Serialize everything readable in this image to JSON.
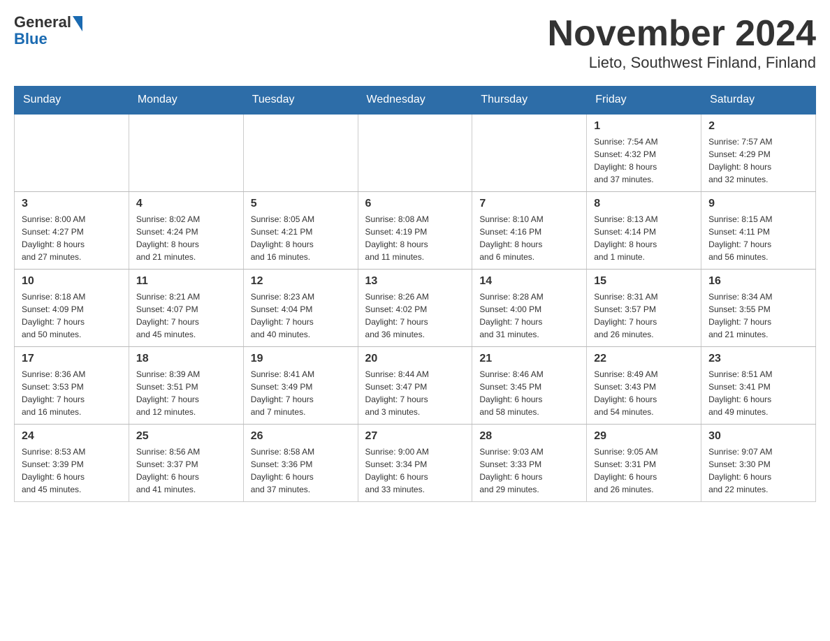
{
  "header": {
    "logo": {
      "general": "General",
      "blue": "Blue"
    },
    "title": "November 2024",
    "subtitle": "Lieto, Southwest Finland, Finland"
  },
  "calendar": {
    "days_of_week": [
      "Sunday",
      "Monday",
      "Tuesday",
      "Wednesday",
      "Thursday",
      "Friday",
      "Saturday"
    ],
    "weeks": [
      [
        {
          "day": "",
          "info": ""
        },
        {
          "day": "",
          "info": ""
        },
        {
          "day": "",
          "info": ""
        },
        {
          "day": "",
          "info": ""
        },
        {
          "day": "",
          "info": ""
        },
        {
          "day": "1",
          "info": "Sunrise: 7:54 AM\nSunset: 4:32 PM\nDaylight: 8 hours\nand 37 minutes."
        },
        {
          "day": "2",
          "info": "Sunrise: 7:57 AM\nSunset: 4:29 PM\nDaylight: 8 hours\nand 32 minutes."
        }
      ],
      [
        {
          "day": "3",
          "info": "Sunrise: 8:00 AM\nSunset: 4:27 PM\nDaylight: 8 hours\nand 27 minutes."
        },
        {
          "day": "4",
          "info": "Sunrise: 8:02 AM\nSunset: 4:24 PM\nDaylight: 8 hours\nand 21 minutes."
        },
        {
          "day": "5",
          "info": "Sunrise: 8:05 AM\nSunset: 4:21 PM\nDaylight: 8 hours\nand 16 minutes."
        },
        {
          "day": "6",
          "info": "Sunrise: 8:08 AM\nSunset: 4:19 PM\nDaylight: 8 hours\nand 11 minutes."
        },
        {
          "day": "7",
          "info": "Sunrise: 8:10 AM\nSunset: 4:16 PM\nDaylight: 8 hours\nand 6 minutes."
        },
        {
          "day": "8",
          "info": "Sunrise: 8:13 AM\nSunset: 4:14 PM\nDaylight: 8 hours\nand 1 minute."
        },
        {
          "day": "9",
          "info": "Sunrise: 8:15 AM\nSunset: 4:11 PM\nDaylight: 7 hours\nand 56 minutes."
        }
      ],
      [
        {
          "day": "10",
          "info": "Sunrise: 8:18 AM\nSunset: 4:09 PM\nDaylight: 7 hours\nand 50 minutes."
        },
        {
          "day": "11",
          "info": "Sunrise: 8:21 AM\nSunset: 4:07 PM\nDaylight: 7 hours\nand 45 minutes."
        },
        {
          "day": "12",
          "info": "Sunrise: 8:23 AM\nSunset: 4:04 PM\nDaylight: 7 hours\nand 40 minutes."
        },
        {
          "day": "13",
          "info": "Sunrise: 8:26 AM\nSunset: 4:02 PM\nDaylight: 7 hours\nand 36 minutes."
        },
        {
          "day": "14",
          "info": "Sunrise: 8:28 AM\nSunset: 4:00 PM\nDaylight: 7 hours\nand 31 minutes."
        },
        {
          "day": "15",
          "info": "Sunrise: 8:31 AM\nSunset: 3:57 PM\nDaylight: 7 hours\nand 26 minutes."
        },
        {
          "day": "16",
          "info": "Sunrise: 8:34 AM\nSunset: 3:55 PM\nDaylight: 7 hours\nand 21 minutes."
        }
      ],
      [
        {
          "day": "17",
          "info": "Sunrise: 8:36 AM\nSunset: 3:53 PM\nDaylight: 7 hours\nand 16 minutes."
        },
        {
          "day": "18",
          "info": "Sunrise: 8:39 AM\nSunset: 3:51 PM\nDaylight: 7 hours\nand 12 minutes."
        },
        {
          "day": "19",
          "info": "Sunrise: 8:41 AM\nSunset: 3:49 PM\nDaylight: 7 hours\nand 7 minutes."
        },
        {
          "day": "20",
          "info": "Sunrise: 8:44 AM\nSunset: 3:47 PM\nDaylight: 7 hours\nand 3 minutes."
        },
        {
          "day": "21",
          "info": "Sunrise: 8:46 AM\nSunset: 3:45 PM\nDaylight: 6 hours\nand 58 minutes."
        },
        {
          "day": "22",
          "info": "Sunrise: 8:49 AM\nSunset: 3:43 PM\nDaylight: 6 hours\nand 54 minutes."
        },
        {
          "day": "23",
          "info": "Sunrise: 8:51 AM\nSunset: 3:41 PM\nDaylight: 6 hours\nand 49 minutes."
        }
      ],
      [
        {
          "day": "24",
          "info": "Sunrise: 8:53 AM\nSunset: 3:39 PM\nDaylight: 6 hours\nand 45 minutes."
        },
        {
          "day": "25",
          "info": "Sunrise: 8:56 AM\nSunset: 3:37 PM\nDaylight: 6 hours\nand 41 minutes."
        },
        {
          "day": "26",
          "info": "Sunrise: 8:58 AM\nSunset: 3:36 PM\nDaylight: 6 hours\nand 37 minutes."
        },
        {
          "day": "27",
          "info": "Sunrise: 9:00 AM\nSunset: 3:34 PM\nDaylight: 6 hours\nand 33 minutes."
        },
        {
          "day": "28",
          "info": "Sunrise: 9:03 AM\nSunset: 3:33 PM\nDaylight: 6 hours\nand 29 minutes."
        },
        {
          "day": "29",
          "info": "Sunrise: 9:05 AM\nSunset: 3:31 PM\nDaylight: 6 hours\nand 26 minutes."
        },
        {
          "day": "30",
          "info": "Sunrise: 9:07 AM\nSunset: 3:30 PM\nDaylight: 6 hours\nand 22 minutes."
        }
      ]
    ]
  }
}
